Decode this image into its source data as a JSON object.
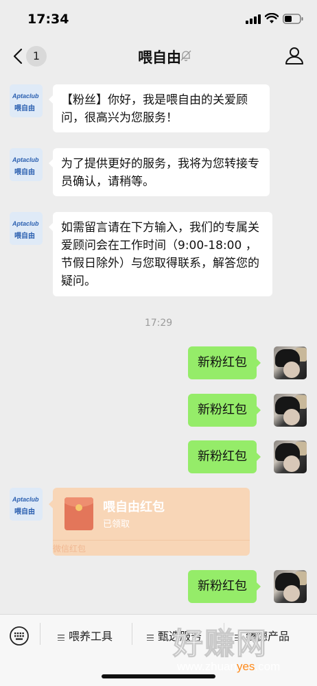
{
  "status_bar": {
    "time": "17:34"
  },
  "header": {
    "unread_count": "1",
    "title": "喂自由"
  },
  "brand_avatar": {
    "top": "Aptaclub",
    "bottom": "喂自由"
  },
  "messages_in": [
    {
      "text": "【粉丝】你好，我是喂自由的关爱顾问，很高兴为您服务！"
    },
    {
      "text": "为了提供更好的服务，我将为您转接专员确认，请稍等。"
    },
    {
      "text": "如需留言请在下方输入，我们的专属关爱顾问会在工作时间（9:00-18:00 ，节假日除外）与您取得联系，解答您的疑问。"
    }
  ],
  "timestamp": "17:29",
  "messages_out": [
    {
      "text": "新粉红包"
    },
    {
      "text": "新粉红包"
    },
    {
      "text": "新粉红包"
    },
    {
      "text": "新粉红包"
    }
  ],
  "red_packet": {
    "title": "喂自由红包",
    "status": "已领取",
    "footer": "微信红包"
  },
  "toolbar": {
    "items": [
      {
        "label": "喂养工具"
      },
      {
        "label": "甄选服务"
      },
      {
        "label": "臻德产品"
      }
    ]
  },
  "watermark": {
    "big": "好赚网",
    "small_a": "www.zhuan",
    "small_b": "yes",
    "small_c": ".com"
  },
  "colors": {
    "background": "#ededed",
    "bubble_out": "#95ec69",
    "bubble_in": "#ffffff",
    "red_packet": "#f8d6b7"
  }
}
